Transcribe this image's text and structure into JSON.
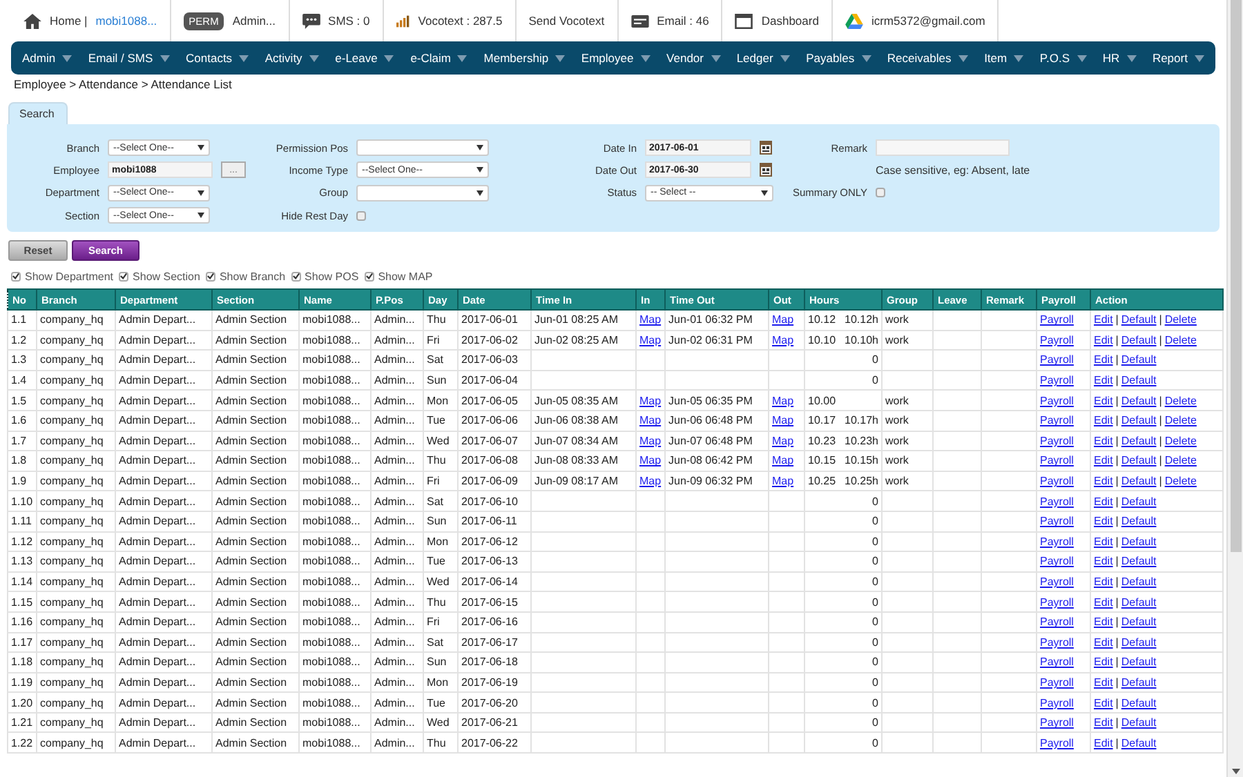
{
  "topbar": [
    {
      "kind": "home",
      "label": "Home |",
      "link": "mobi1088..."
    },
    {
      "kind": "badge",
      "badge": "PERM",
      "label": "Admin..."
    },
    {
      "kind": "sms",
      "label": "SMS : 0"
    },
    {
      "kind": "vocotext",
      "label": "Vocotext : 287.5"
    },
    {
      "kind": "plain",
      "label": "Send Vocotext"
    },
    {
      "kind": "email",
      "label": "Email : 46"
    },
    {
      "kind": "dashboard",
      "label": "Dashboard"
    },
    {
      "kind": "drive",
      "label": "icrm5372@gmail.com"
    }
  ],
  "menu": [
    "Admin",
    "Email / SMS",
    "Contacts",
    "Activity",
    "e-Leave",
    "e-Claim",
    "Membership",
    "Employee",
    "Vendor",
    "Ledger",
    "Payables",
    "Receivables",
    "Item",
    "P.O.S",
    "HR",
    "Report"
  ],
  "breadcrumb": "Employee > Attendance > Attendance List",
  "search_tab": "Search",
  "search_form": [
    [
      {
        "kind": "select",
        "label": "Branch",
        "value": "--Select One--"
      },
      {
        "kind": "text",
        "label": "Employee",
        "value": "mobi1088",
        "browse": "..."
      },
      {
        "kind": "select",
        "label": "Department",
        "value": "--Select One--"
      },
      {
        "kind": "select",
        "label": "Section",
        "value": "--Select One--"
      }
    ],
    [
      {
        "kind": "select",
        "label": "Permission Pos"
      },
      {
        "kind": "select",
        "label": "Income Type",
        "value": "--Select One--"
      },
      {
        "kind": "select",
        "label": "Group"
      },
      {
        "kind": "checkbox",
        "label": "Hide Rest Day",
        "checked": false
      }
    ],
    [
      {
        "kind": "date",
        "label": "Date In",
        "value": "2017-06-01"
      },
      {
        "kind": "date",
        "label": "Date Out",
        "value": "2017-06-30"
      },
      {
        "kind": "select",
        "label": "Status",
        "value": "-- Select --"
      }
    ],
    [
      {
        "kind": "text",
        "label": "Remark"
      },
      {
        "kind": "note",
        "text": "Case sensitive, eg: Absent, late"
      },
      {
        "kind": "checkbox",
        "label": "Summary ONLY",
        "checked": false
      }
    ]
  ],
  "buttons": [
    {
      "kind": "reset",
      "label": "Reset"
    },
    {
      "kind": "search",
      "label": "Search"
    }
  ],
  "show_options": [
    {
      "label": "Show Department",
      "checked": true
    },
    {
      "label": "Show Section",
      "checked": true
    },
    {
      "label": "Show Branch",
      "checked": true
    },
    {
      "label": "Show POS",
      "checked": true
    },
    {
      "label": "Show MAP",
      "checked": true
    }
  ],
  "table": {
    "columns": [
      "No",
      "Branch",
      "Department",
      "Section",
      "Name",
      "P.Pos",
      "Day",
      "Date",
      "Time In",
      "In",
      "Time Out",
      "Out",
      "Hours",
      "Group",
      "Leave",
      "Remark",
      "Payroll",
      "Action"
    ],
    "action_separator": "|",
    "rows": [
      {
        "no": "1.1",
        "branch": "company_hq",
        "department": "Admin Depart...",
        "section": "Admin Section",
        "name": "mobi1088...",
        "pos": "Admin...",
        "day": "Thu",
        "date": "2017-06-01",
        "time_in": "Jun-01 08:25 AM",
        "in_map": "Map",
        "time_out": "Jun-01 06:32 PM",
        "out_map": "Map",
        "hours": "10.12",
        "hours_total": "10.12h",
        "group": "work",
        "payroll": "Payroll",
        "actions": [
          "Edit",
          "Default",
          "Delete"
        ]
      },
      {
        "no": "1.2",
        "branch": "company_hq",
        "department": "Admin Depart...",
        "section": "Admin Section",
        "name": "mobi1088...",
        "pos": "Admin...",
        "day": "Fri",
        "date": "2017-06-02",
        "time_in": "Jun-02 08:25 AM",
        "in_map": "Map",
        "time_out": "Jun-02 06:31 PM",
        "out_map": "Map",
        "hours": "10.10",
        "hours_total": "10.10h",
        "group": "work",
        "payroll": "Payroll",
        "actions": [
          "Edit",
          "Default",
          "Delete"
        ]
      },
      {
        "no": "1.3",
        "branch": "company_hq",
        "department": "Admin Depart...",
        "section": "Admin Section",
        "name": "mobi1088...",
        "pos": "Admin...",
        "day": "Sat",
        "date": "2017-06-03",
        "hours": "0",
        "payroll": "Payroll",
        "actions": [
          "Edit",
          "Default"
        ]
      },
      {
        "no": "1.4",
        "branch": "company_hq",
        "department": "Admin Depart...",
        "section": "Admin Section",
        "name": "mobi1088...",
        "pos": "Admin...",
        "day": "Sun",
        "date": "2017-06-04",
        "hours": "0",
        "payroll": "Payroll",
        "actions": [
          "Edit",
          "Default"
        ]
      },
      {
        "no": "1.5",
        "branch": "company_hq",
        "department": "Admin Depart...",
        "section": "Admin Section",
        "name": "mobi1088...",
        "pos": "Admin...",
        "day": "Mon",
        "date": "2017-06-05",
        "time_in": "Jun-05 08:35 AM",
        "in_map": "Map",
        "time_out": "Jun-05 06:35 PM",
        "out_map": "Map",
        "hours": "10.00",
        "group": "work",
        "payroll": "Payroll",
        "actions": [
          "Edit",
          "Default",
          "Delete"
        ]
      },
      {
        "no": "1.6",
        "branch": "company_hq",
        "department": "Admin Depart...",
        "section": "Admin Section",
        "name": "mobi1088...",
        "pos": "Admin...",
        "day": "Tue",
        "date": "2017-06-06",
        "time_in": "Jun-06 08:38 AM",
        "in_map": "Map",
        "time_out": "Jun-06 06:48 PM",
        "out_map": "Map",
        "hours": "10.17",
        "hours_total": "10.17h",
        "group": "work",
        "payroll": "Payroll",
        "actions": [
          "Edit",
          "Default",
          "Delete"
        ]
      },
      {
        "no": "1.7",
        "branch": "company_hq",
        "department": "Admin Depart...",
        "section": "Admin Section",
        "name": "mobi1088...",
        "pos": "Admin...",
        "day": "Wed",
        "date": "2017-06-07",
        "time_in": "Jun-07 08:34 AM",
        "in_map": "Map",
        "time_out": "Jun-07 06:48 PM",
        "out_map": "Map",
        "hours": "10.23",
        "hours_total": "10.23h",
        "group": "work",
        "payroll": "Payroll",
        "actions": [
          "Edit",
          "Default",
          "Delete"
        ]
      },
      {
        "no": "1.8",
        "branch": "company_hq",
        "department": "Admin Depart...",
        "section": "Admin Section",
        "name": "mobi1088...",
        "pos": "Admin...",
        "day": "Thu",
        "date": "2017-06-08",
        "time_in": "Jun-08 08:33 AM",
        "in_map": "Map",
        "time_out": "Jun-08 06:42 PM",
        "out_map": "Map",
        "hours": "10.15",
        "hours_total": "10.15h",
        "group": "work",
        "payroll": "Payroll",
        "actions": [
          "Edit",
          "Default",
          "Delete"
        ]
      },
      {
        "no": "1.9",
        "branch": "company_hq",
        "department": "Admin Depart...",
        "section": "Admin Section",
        "name": "mobi1088...",
        "pos": "Admin...",
        "day": "Fri",
        "date": "2017-06-09",
        "time_in": "Jun-09 08:17 AM",
        "in_map": "Map",
        "time_out": "Jun-09 06:32 PM",
        "out_map": "Map",
        "hours": "10.25",
        "hours_total": "10.25h",
        "group": "work",
        "payroll": "Payroll",
        "actions": [
          "Edit",
          "Default",
          "Delete"
        ]
      },
      {
        "no": "1.10",
        "branch": "company_hq",
        "department": "Admin Depart...",
        "section": "Admin Section",
        "name": "mobi1088...",
        "pos": "Admin...",
        "day": "Sat",
        "date": "2017-06-10",
        "hours": "0",
        "payroll": "Payroll",
        "actions": [
          "Edit",
          "Default"
        ]
      },
      {
        "no": "1.11",
        "branch": "company_hq",
        "department": "Admin Depart...",
        "section": "Admin Section",
        "name": "mobi1088...",
        "pos": "Admin...",
        "day": "Sun",
        "date": "2017-06-11",
        "hours": "0",
        "payroll": "Payroll",
        "actions": [
          "Edit",
          "Default"
        ]
      },
      {
        "no": "1.12",
        "branch": "company_hq",
        "department": "Admin Depart...",
        "section": "Admin Section",
        "name": "mobi1088...",
        "pos": "Admin...",
        "day": "Mon",
        "date": "2017-06-12",
        "hours": "0",
        "payroll": "Payroll",
        "actions": [
          "Edit",
          "Default"
        ]
      },
      {
        "no": "1.13",
        "branch": "company_hq",
        "department": "Admin Depart...",
        "section": "Admin Section",
        "name": "mobi1088...",
        "pos": "Admin...",
        "day": "Tue",
        "date": "2017-06-13",
        "hours": "0",
        "payroll": "Payroll",
        "actions": [
          "Edit",
          "Default"
        ]
      },
      {
        "no": "1.14",
        "branch": "company_hq",
        "department": "Admin Depart...",
        "section": "Admin Section",
        "name": "mobi1088...",
        "pos": "Admin...",
        "day": "Wed",
        "date": "2017-06-14",
        "hours": "0",
        "payroll": "Payroll",
        "actions": [
          "Edit",
          "Default"
        ]
      },
      {
        "no": "1.15",
        "branch": "company_hq",
        "department": "Admin Depart...",
        "section": "Admin Section",
        "name": "mobi1088...",
        "pos": "Admin...",
        "day": "Thu",
        "date": "2017-06-15",
        "hours": "0",
        "payroll": "Payroll",
        "actions": [
          "Edit",
          "Default"
        ]
      },
      {
        "no": "1.16",
        "branch": "company_hq",
        "department": "Admin Depart...",
        "section": "Admin Section",
        "name": "mobi1088...",
        "pos": "Admin...",
        "day": "Fri",
        "date": "2017-06-16",
        "hours": "0",
        "payroll": "Payroll",
        "actions": [
          "Edit",
          "Default"
        ]
      },
      {
        "no": "1.17",
        "branch": "company_hq",
        "department": "Admin Depart...",
        "section": "Admin Section",
        "name": "mobi1088...",
        "pos": "Admin...",
        "day": "Sat",
        "date": "2017-06-17",
        "hours": "0",
        "payroll": "Payroll",
        "actions": [
          "Edit",
          "Default"
        ]
      },
      {
        "no": "1.18",
        "branch": "company_hq",
        "department": "Admin Depart...",
        "section": "Admin Section",
        "name": "mobi1088...",
        "pos": "Admin...",
        "day": "Sun",
        "date": "2017-06-18",
        "hours": "0",
        "payroll": "Payroll",
        "actions": [
          "Edit",
          "Default"
        ]
      },
      {
        "no": "1.19",
        "branch": "company_hq",
        "department": "Admin Depart...",
        "section": "Admin Section",
        "name": "mobi1088...",
        "pos": "Admin...",
        "day": "Mon",
        "date": "2017-06-19",
        "hours": "0",
        "payroll": "Payroll",
        "actions": [
          "Edit",
          "Default"
        ]
      },
      {
        "no": "1.20",
        "branch": "company_hq",
        "department": "Admin Depart...",
        "section": "Admin Section",
        "name": "mobi1088...",
        "pos": "Admin...",
        "day": "Tue",
        "date": "2017-06-20",
        "hours": "0",
        "payroll": "Payroll",
        "actions": [
          "Edit",
          "Default"
        ]
      },
      {
        "no": "1.21",
        "branch": "company_hq",
        "department": "Admin Depart...",
        "section": "Admin Section",
        "name": "mobi1088...",
        "pos": "Admin...",
        "day": "Wed",
        "date": "2017-06-21",
        "hours": "0",
        "payroll": "Payroll",
        "actions": [
          "Edit",
          "Default"
        ]
      },
      {
        "no": "1.22",
        "branch": "company_hq",
        "department": "Admin Depart...",
        "section": "Admin Section",
        "name": "mobi1088...",
        "pos": "Admin...",
        "day": "Thu",
        "date": "2017-06-22",
        "hours": "0",
        "payroll": "Payroll",
        "actions": [
          "Edit",
          "Default"
        ]
      }
    ]
  }
}
